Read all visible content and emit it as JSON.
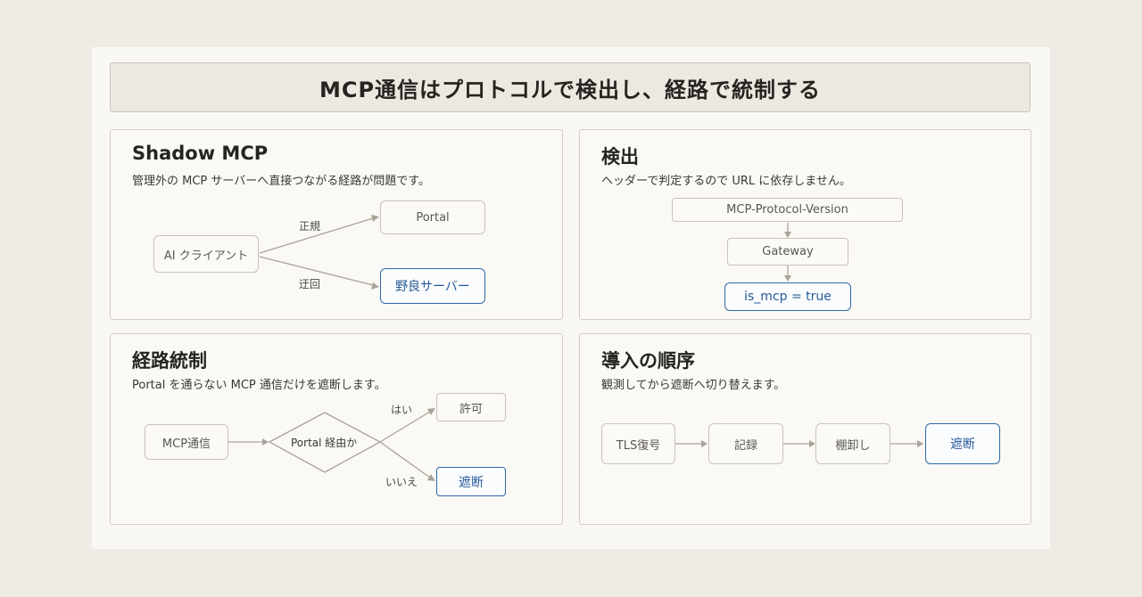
{
  "banner": {
    "title": "MCP通信はプロトコルで検出し、経路で統制する"
  },
  "shadow": {
    "title": "Shadow MCP",
    "desc": "管理外の MCP サーバーへ直接つながる経路が問題です。",
    "client": "AI クライアント",
    "portal": "Portal",
    "wild": "野良サーバー",
    "legit_label": "正規",
    "bypass_label": "迂回"
  },
  "detect": {
    "title": "検出",
    "desc": "ヘッダーで判定するので URL に依存しません。",
    "header": "MCP-Protocol-Version",
    "gateway": "Gateway",
    "result": "is_mcp = true"
  },
  "route": {
    "title": "経路統制",
    "desc": "Portal を通らない MCP 通信だけを遮断します。",
    "source": "MCP通信",
    "decision": "Portal 経由か",
    "yes_label": "はい",
    "no_label": "いいえ",
    "allow": "許可",
    "block": "遮断"
  },
  "order": {
    "title": "導入の順序",
    "desc": "観測してから遮断へ切り替えます。",
    "steps": [
      "TLS復号",
      "記録",
      "棚卸し",
      "遮断"
    ]
  },
  "colors": {
    "accent": "#2f68a8",
    "border": "#c9c3b8",
    "background": "#efece6"
  }
}
